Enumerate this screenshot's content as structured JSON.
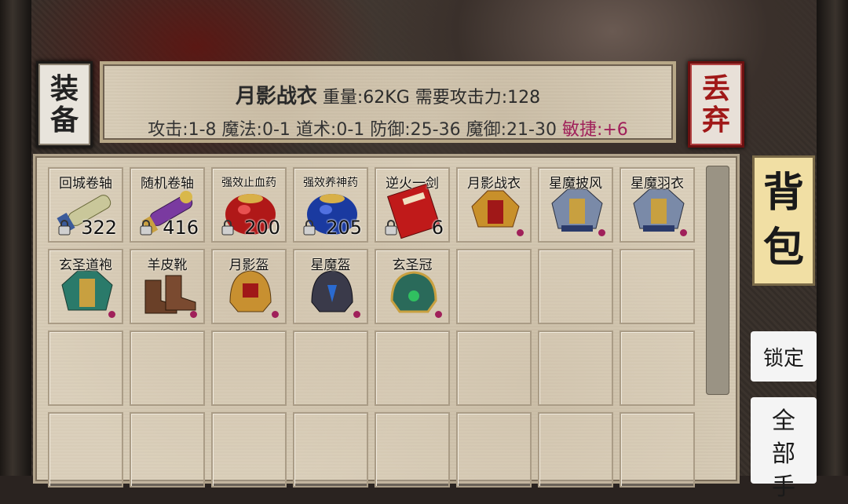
{
  "buttons": {
    "equip": [
      "装",
      "备"
    ],
    "discard": [
      "丢",
      "弃"
    ],
    "bag_tab": [
      "背",
      "包"
    ],
    "lock": "锁定",
    "all": [
      "全",
      "部",
      "手"
    ]
  },
  "item_detail": {
    "name": "月影战衣",
    "weight": "重量:62KG",
    "requirement": "需要攻击力:128",
    "attack": "攻击:1-8",
    "magic": "魔法:0-1",
    "taoism": "道术:0-1",
    "defense": "防御:25-36",
    "magic_defense": "魔御:21-30",
    "agility": "敏捷:+6"
  },
  "colors": {
    "agility_bonus": "#a0205a",
    "bag_tab_bg": "#f1dfa4",
    "discard_text": "#a01818"
  },
  "inventory": [
    {
      "label": "回城卷轴",
      "count": "322",
      "icon": "scroll-icon"
    },
    {
      "label": "随机卷轴",
      "count": "416",
      "icon": "purple-scroll-icon"
    },
    {
      "label": "强效止血药",
      "count": "200",
      "icon": "red-potion-icon"
    },
    {
      "label": "强效养神药",
      "count": "205",
      "icon": "blue-potion-icon"
    },
    {
      "label": "逆火一剑",
      "count": "6",
      "icon": "red-book-icon"
    },
    {
      "label": "月影战衣",
      "icon": "gold-armor-icon"
    },
    {
      "label": "星魔披风",
      "icon": "steel-armor-icon"
    },
    {
      "label": "星魔羽衣",
      "icon": "steel-armor-icon"
    },
    {
      "label": "玄圣道袍",
      "icon": "green-robe-icon"
    },
    {
      "label": "羊皮靴",
      "icon": "boots-icon"
    },
    {
      "label": "月影盔",
      "icon": "gold-helmet-icon"
    },
    {
      "label": "星魔盔",
      "icon": "dark-helmet-icon"
    },
    {
      "label": "玄圣冠",
      "icon": "jade-crown-icon"
    }
  ]
}
